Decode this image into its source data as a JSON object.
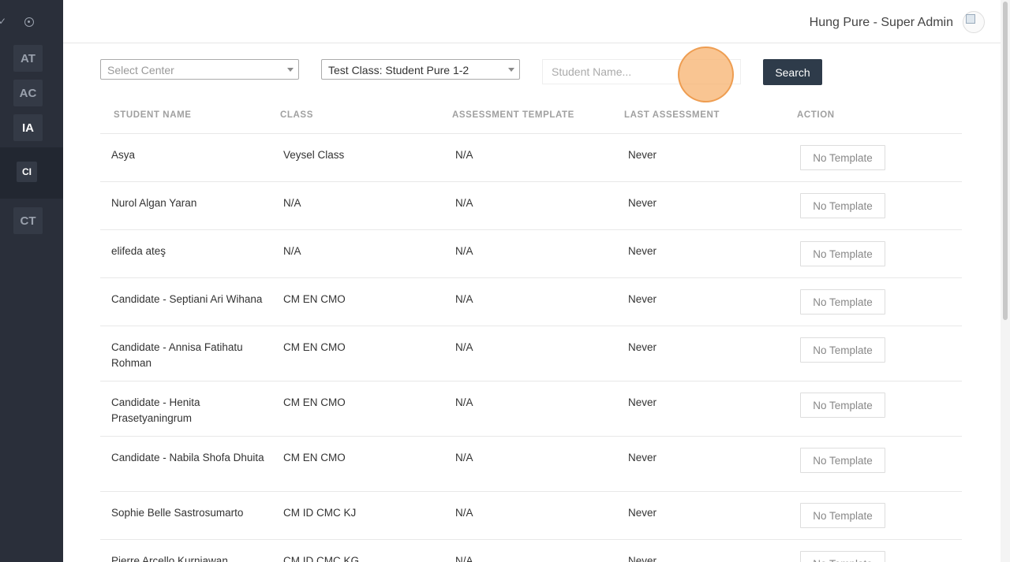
{
  "sidebar": {
    "items": [
      {
        "label": "AT",
        "active": false
      },
      {
        "label": "AC",
        "active": false
      },
      {
        "label": "IA",
        "active": true
      },
      {
        "label": "CI",
        "active": true
      },
      {
        "label": "CT",
        "active": false
      }
    ]
  },
  "header": {
    "user_name": "Hung Pure - Super Admin"
  },
  "filters": {
    "center_placeholder": "Select Center",
    "class_value": "Test Class: Student Pure 1-2",
    "student_name_placeholder": "Student Name...",
    "search_label": "Search"
  },
  "table": {
    "columns": [
      "STUDENT NAME",
      "CLASS",
      "ASSESSMENT TEMPLATE",
      "LAST ASSESSMENT",
      "ACTION"
    ],
    "rows": [
      {
        "name": "Asya",
        "class": "Veysel Class",
        "template": "N/A",
        "last": "Never",
        "action": "No Template"
      },
      {
        "name": "Nurol Algan Yaran",
        "class": "N/A",
        "template": "N/A",
        "last": "Never",
        "action": "No Template"
      },
      {
        "name": "elifeda ateş",
        "class": "N/A",
        "template": "N/A",
        "last": "Never",
        "action": "No Template"
      },
      {
        "name": "Candidate - Septiani Ari Wihana",
        "class": "CM EN CMO",
        "template": "N/A",
        "last": "Never",
        "action": "No Template"
      },
      {
        "name": "Candidate - Annisa Fatihatu Rohman",
        "class": "CM EN CMO",
        "template": "N/A",
        "last": "Never",
        "action": "No Template"
      },
      {
        "name": "Candidate - Henita Prasetyaningrum",
        "class": "CM EN CMO",
        "template": "N/A",
        "last": "Never",
        "action": "No Template"
      },
      {
        "name": "Candidate - Nabila Shofa Dhuita",
        "class": "CM EN CMO",
        "template": "N/A",
        "last": "Never",
        "action": "No Template"
      },
      {
        "name": "Sophie Belle Sastrosumarto",
        "class": "CM ID CMC KJ",
        "template": "N/A",
        "last": "Never",
        "action": "No Template"
      },
      {
        "name": "Pierre Arcello Kurniawan",
        "class": "CM ID CMC KG",
        "template": "N/A",
        "last": "Never",
        "action": "No Template"
      }
    ]
  }
}
